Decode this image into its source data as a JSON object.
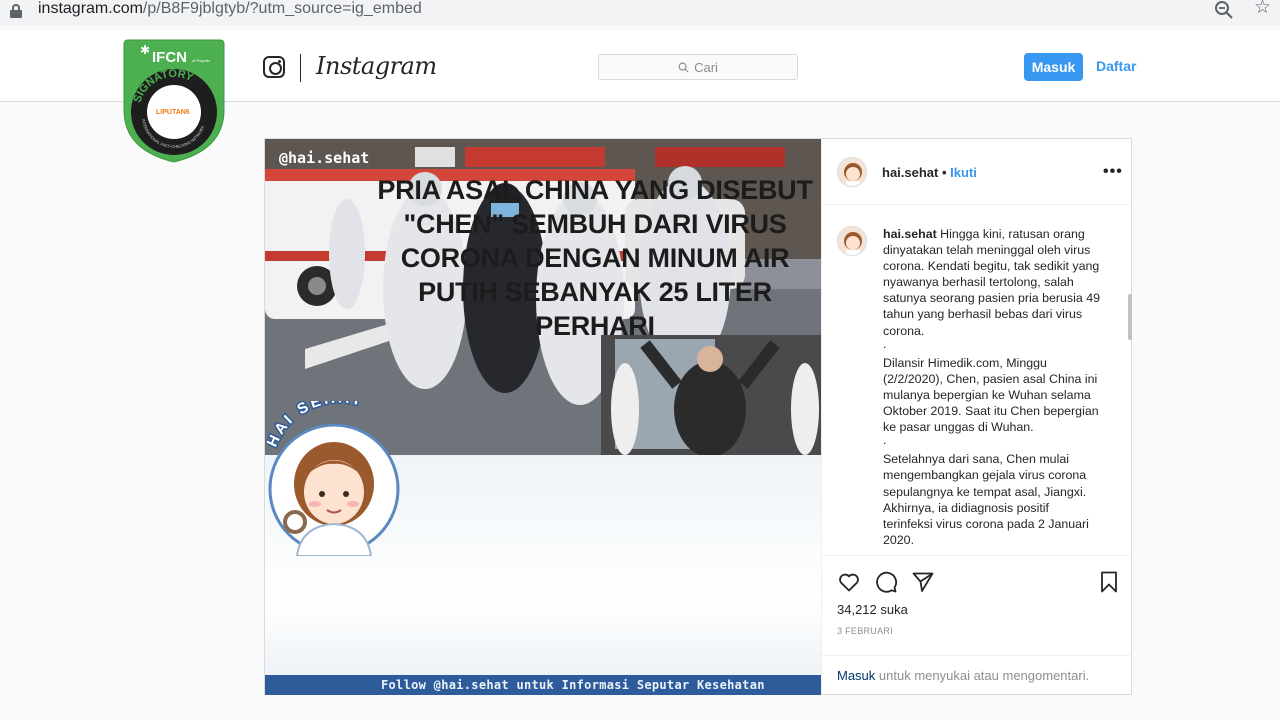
{
  "browser": {
    "url_host": "instagram.com",
    "url_rest": "/p/B8F9jblgtyb/?utm_source=ig_embed"
  },
  "header": {
    "wordmark": "Instagram",
    "search_placeholder": "Cari",
    "login_label": "Masuk",
    "signup_label": "Daftar"
  },
  "badge": {
    "org": "IFCN",
    "org_small": "of Poynter",
    "ring_text": "SIGNATORY",
    "center": "LIPUTAN6",
    "bottom_text": "INTERNATIONAL FACT-CHECKING NETWORK"
  },
  "post": {
    "username": "hai.sehat",
    "dot": "•",
    "follow_label": "Ikuti",
    "more": "•••",
    "caption": {
      "user": "hai.sehat",
      "para1": "Hingga kini, ratusan orang dinyatakan telah meninggal oleh virus corona. Kendati begitu, tak sedikit yang nyawanya berhasil tertolong, salah satunya seorang pasien pria berusia 49 tahun yang berhasil bebas dari virus corona.",
      "sep": ".",
      "para2": "Dilansir Himedik.com, Minggu (2/2/2020), Chen, pasien asal China ini mulanya bepergian ke Wuhan selama Oktober 2019. Saat itu Chen bepergian ke pasar unggas di Wuhan.",
      "para3": "Setelahnya dari sana, Chen mulai mengembangkan gejala virus corona sepulangnya ke tempat asal, Jiangxi. Akhirnya, ia didiagnosis positif terinfeksi virus corona pada 2 Januari 2020."
    },
    "likes": "34,212 suka",
    "date": "3 FEBRUARI",
    "login_prompt_link": "Masuk",
    "login_prompt_rest": " untuk menyukai atau mengomentari."
  },
  "media": {
    "handle_tag": "@hai.sehat",
    "brand_arc": "HAI SEHAT",
    "headline": "PRIA ASAL CHINA YANG DISEBUT \"CHEN\" SEMBUH DARI VIRUS CORONA DENGAN MINUM AIR PUTIH SEBANYAK 25 LITER PERHARI",
    "follow_line": "Follow @hai.sehat untuk Informasi Seputar Kesehatan"
  },
  "colors": {
    "ig_blue": "#3897f0",
    "ifcn_green": "#4caf50",
    "follow_bar": "#2e5c9a"
  }
}
